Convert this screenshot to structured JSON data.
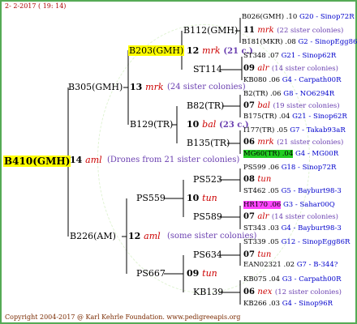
{
  "header": {
    "date": "2- 2-2017 ( 19: 14)"
  },
  "root": {
    "label": "B410(GMH)",
    "gen": "14",
    "mark": "aml",
    "note": "(Drones from 21 sister colonies)"
  },
  "upper": {
    "label": "B305(GMH)",
    "gen": "13",
    "mark": "mrk",
    "note": "(24 sister colonies)",
    "a": {
      "label": "B203(GMH)",
      "gen": "12",
      "mark": "mrk",
      "note": "(21 c.)",
      "a": {
        "label": "B112(GMH)",
        "gen": "11",
        "mark": "mrk",
        "note": "(22 sister colonies)",
        "top": {
          "name": "B026(GMH) .10",
          "loc": "G20 - Sinop72R"
        },
        "bot": {
          "name": "B181(MKR) .08",
          "loc": "G2 - SinopEgg86R"
        }
      },
      "b": {
        "label": "ST114",
        "gen": "09",
        "mark": "alr",
        "note": "(14 sister colonies)",
        "top": {
          "name": "ST348 .07",
          "loc": "G21 - Sinop62R"
        },
        "bot": {
          "name": "KB080 .06",
          "loc": "G4 - Carpath00R"
        }
      }
    },
    "b": {
      "label": "B129(TR)",
      "gen": "10",
      "mark": "bal",
      "note": "(23 c.)",
      "a": {
        "label": "B82(TR)",
        "gen": "07",
        "mark": "bal",
        "note": "(19 sister colonies)",
        "top": {
          "name": "B2(TR) .06",
          "loc": "G8 - NO6294R"
        },
        "bot": {
          "name": "B175(TR) .04",
          "loc": "G21 - Sinop62R"
        }
      },
      "b": {
        "label": "B135(TR)",
        "gen": "06",
        "mark": "mrk",
        "note": "(21 sister colonies)",
        "top": {
          "name": "I177(TR) .05",
          "loc": "G7 - Takab93aR"
        },
        "bot": {
          "name": "MG60(TR) .04",
          "loc": "G4 - MG00R"
        }
      }
    }
  },
  "lower": {
    "label": "B226(AM)",
    "gen": "12",
    "mark": "aml",
    "note": "(some sister colonies)",
    "a": {
      "label": "PS559",
      "gen": "10",
      "mark": "tun",
      "note": "",
      "a": {
        "label": "PS523",
        "gen": "08",
        "mark": "tun",
        "note": "",
        "top": {
          "name": "PS599 .06",
          "loc": "G18 - Sinop72R"
        },
        "bot": {
          "name": "ST462 .05",
          "loc": "G5 - Bayburt98-3"
        }
      },
      "b": {
        "label": "PS589",
        "gen": "07",
        "mark": "alr",
        "note": "(14 sister colonies)",
        "top": {
          "name": "HR170 .06",
          "loc": "G3 - Sahar00Q"
        },
        "bot": {
          "name": "ST343 .03",
          "loc": "G4 - Bayburt98-3"
        }
      }
    },
    "b": {
      "label": "PS667",
      "gen": "09",
      "mark": "tun",
      "note": "",
      "a": {
        "label": "PS634",
        "gen": "07",
        "mark": "tun",
        "note": "",
        "top": {
          "name": "ST339 .05",
          "loc": "G12 - SinopEgg86R"
        },
        "bot": {
          "name": "EAN02321 .02",
          "loc": "G7 - B-344?"
        }
      },
      "b": {
        "label": "KB139",
        "gen": "06",
        "mark": "nex",
        "note": "(12 sister colonies)",
        "top": {
          "name": "KB075 .04",
          "loc": "G3 - Carpath00R"
        },
        "bot": {
          "name": "KB266 .03",
          "loc": "G4 - Sinop96R"
        }
      }
    }
  },
  "footer": {
    "text": "Copyright 2004-2017 @ Karl Kehrle Foundation.   www.pedigreeapis.org"
  },
  "colors": {
    "line": "#000000",
    "highlight_root": "#ffff00",
    "highlight_b203": "#ffff00",
    "highlight_mg60": "#22cc22",
    "highlight_hr170": "#ff44ff",
    "mark": "#cc0000",
    "note": "#6a3fb0",
    "loc": "#0000cc"
  }
}
